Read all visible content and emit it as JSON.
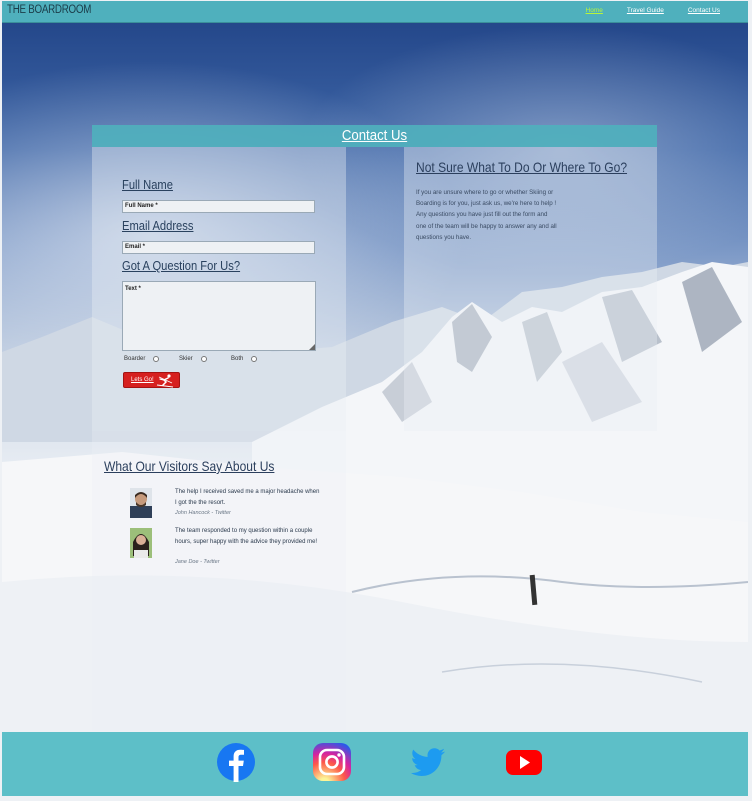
{
  "site": {
    "brand": "THE BOARDROOM"
  },
  "nav": {
    "links": [
      {
        "label": "Home",
        "active": true
      },
      {
        "label": "Travel Guide",
        "active": false
      },
      {
        "label": "Contact Us",
        "active": false
      }
    ]
  },
  "contact": {
    "title": "Contact Us",
    "form": {
      "full_name_label": "Full Name",
      "full_name_placeholder": "Full Name *",
      "email_label": "Email Address",
      "email_placeholder": "Email *",
      "question_label": "Got A Question For Us?",
      "question_placeholder": "Text *",
      "options": [
        "Boarder",
        "Skier",
        "Both"
      ],
      "submit_label": "Lets Go!"
    },
    "info": {
      "title": "Not Sure What To Do Or Where To Go?",
      "lines": [
        "If you are unsure where to go or whether Skiing or",
        "Boarding is for you, just ask us, we're here to help !",
        "Any questions you have just fill out the form and",
        "one of the team will be happy to answer any and all",
        "questions you have."
      ]
    }
  },
  "testimonials": {
    "title": "What Our Visitors Say About Us",
    "items": [
      {
        "quote": "The help I received saved me a major headache when I got the the resort.",
        "author": "John Hancock - Twitter"
      },
      {
        "quote": "The team responded to my question within a couple hours, super happy with the advice they provided me!",
        "author": "Jane Doe - Twitter"
      }
    ]
  },
  "footer": {
    "social": [
      "facebook-icon",
      "instagram-icon",
      "twitter-icon",
      "youtube-icon"
    ]
  },
  "colors": {
    "nav_bg": "#4fb0bd",
    "active_link": "#b8f53a",
    "submit_bg": "#d6201f",
    "footer_bg": "#5dbfc8"
  }
}
